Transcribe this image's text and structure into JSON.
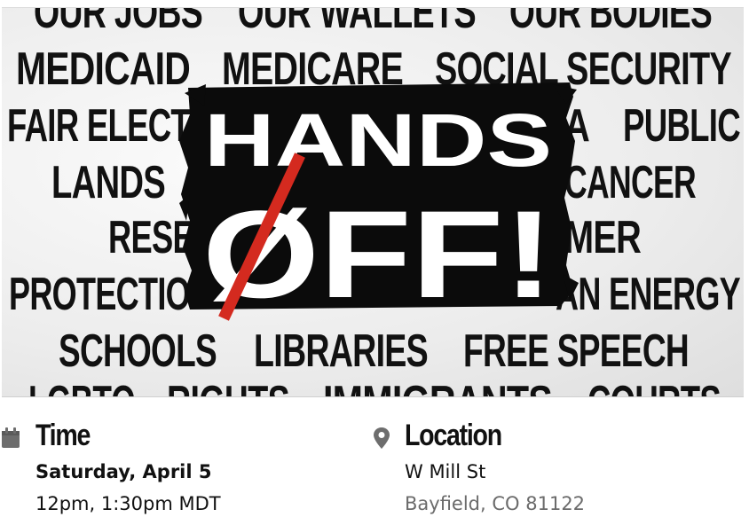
{
  "banner": {
    "rows": [
      [
        "OUR JOBS",
        "OUR WALLETS",
        "OUR BODIES"
      ],
      [
        "MEDICAID",
        "MEDICARE",
        "SOCIAL SECURITY"
      ],
      [
        "FAIR ELECT",
        "A",
        "PUBLIC"
      ],
      [
        "LANDS",
        "CANCER"
      ],
      [
        "RESE",
        "MER"
      ],
      [
        "PROTECTIO",
        "AN ENERGY"
      ],
      [
        "SCHOOLS",
        "LIBRARIES",
        "FREE SPEECH"
      ],
      [
        "LGBTQ",
        "RIGHTS",
        "IMMIGRANTS",
        "COURTS"
      ]
    ],
    "headline_top": "HANDS",
    "headline_bottom": "ØFF!",
    "accent_color": "#d42a1f"
  },
  "time": {
    "icon": "calendar-icon",
    "heading": "Time",
    "date": "Saturday, April 5",
    "hours": "12pm, 1:30pm MDT"
  },
  "location": {
    "icon": "map-pin-icon",
    "heading": "Location",
    "street": "W Mill St",
    "city": "Bayfield, CO 81122"
  }
}
